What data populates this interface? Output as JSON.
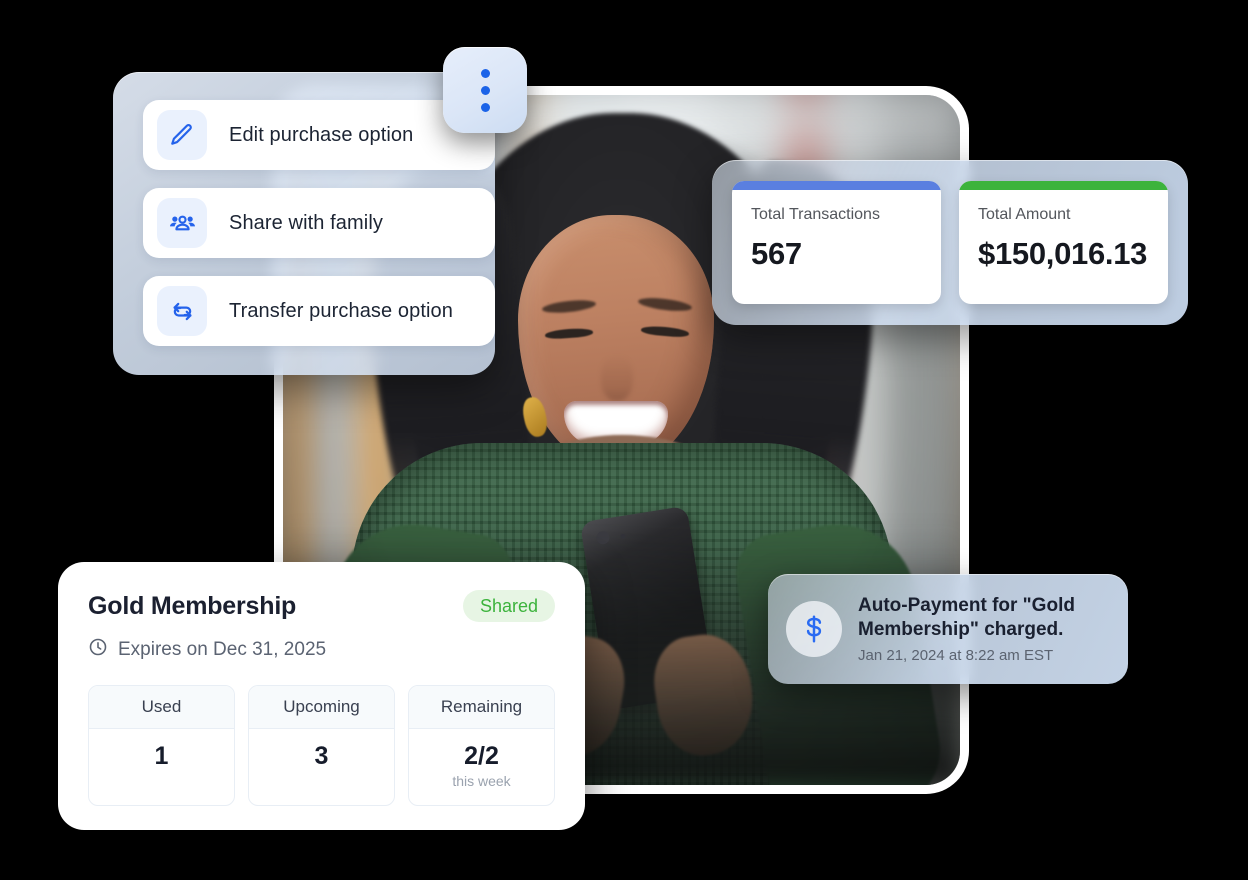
{
  "actions_menu": {
    "items": [
      {
        "icon": "pencil-icon",
        "label": "Edit purchase option"
      },
      {
        "icon": "group-people-icon",
        "label": "Share with family"
      },
      {
        "icon": "transfer-arrows-icon",
        "label": "Transfer purchase option"
      }
    ]
  },
  "overflow_menu_button": {
    "icon": "kebab-menu-icon"
  },
  "stats_panel": {
    "cards": [
      {
        "label": "Total Transactions",
        "value": "567",
        "accent": "#5a7fe0"
      },
      {
        "label": "Total Amount",
        "value": "$150,016.13",
        "accent": "#3cb33c"
      }
    ]
  },
  "membership_card": {
    "title": "Gold Membership",
    "badge": "Shared",
    "expiry_icon": "clock-icon",
    "expiry": "Expires on Dec 31, 2025",
    "stats": [
      {
        "header": "Used",
        "value": "1",
        "sub": ""
      },
      {
        "header": "Upcoming",
        "value": "3",
        "sub": ""
      },
      {
        "header": "Remaining",
        "value": "2/2",
        "sub": "this week"
      }
    ]
  },
  "notification": {
    "icon": "dollar-sign-icon",
    "title": "Auto-Payment for \"Gold Membership\" charged.",
    "timestamp": "Jan 21, 2024 at 8:22 am EST"
  },
  "colors": {
    "accent_blue": "#1b63e8",
    "accent_green": "#3cb33c",
    "bar_blue": "#5a7fe0",
    "bar_green": "#3cb33c",
    "badge_bg": "#e7f5e4"
  }
}
